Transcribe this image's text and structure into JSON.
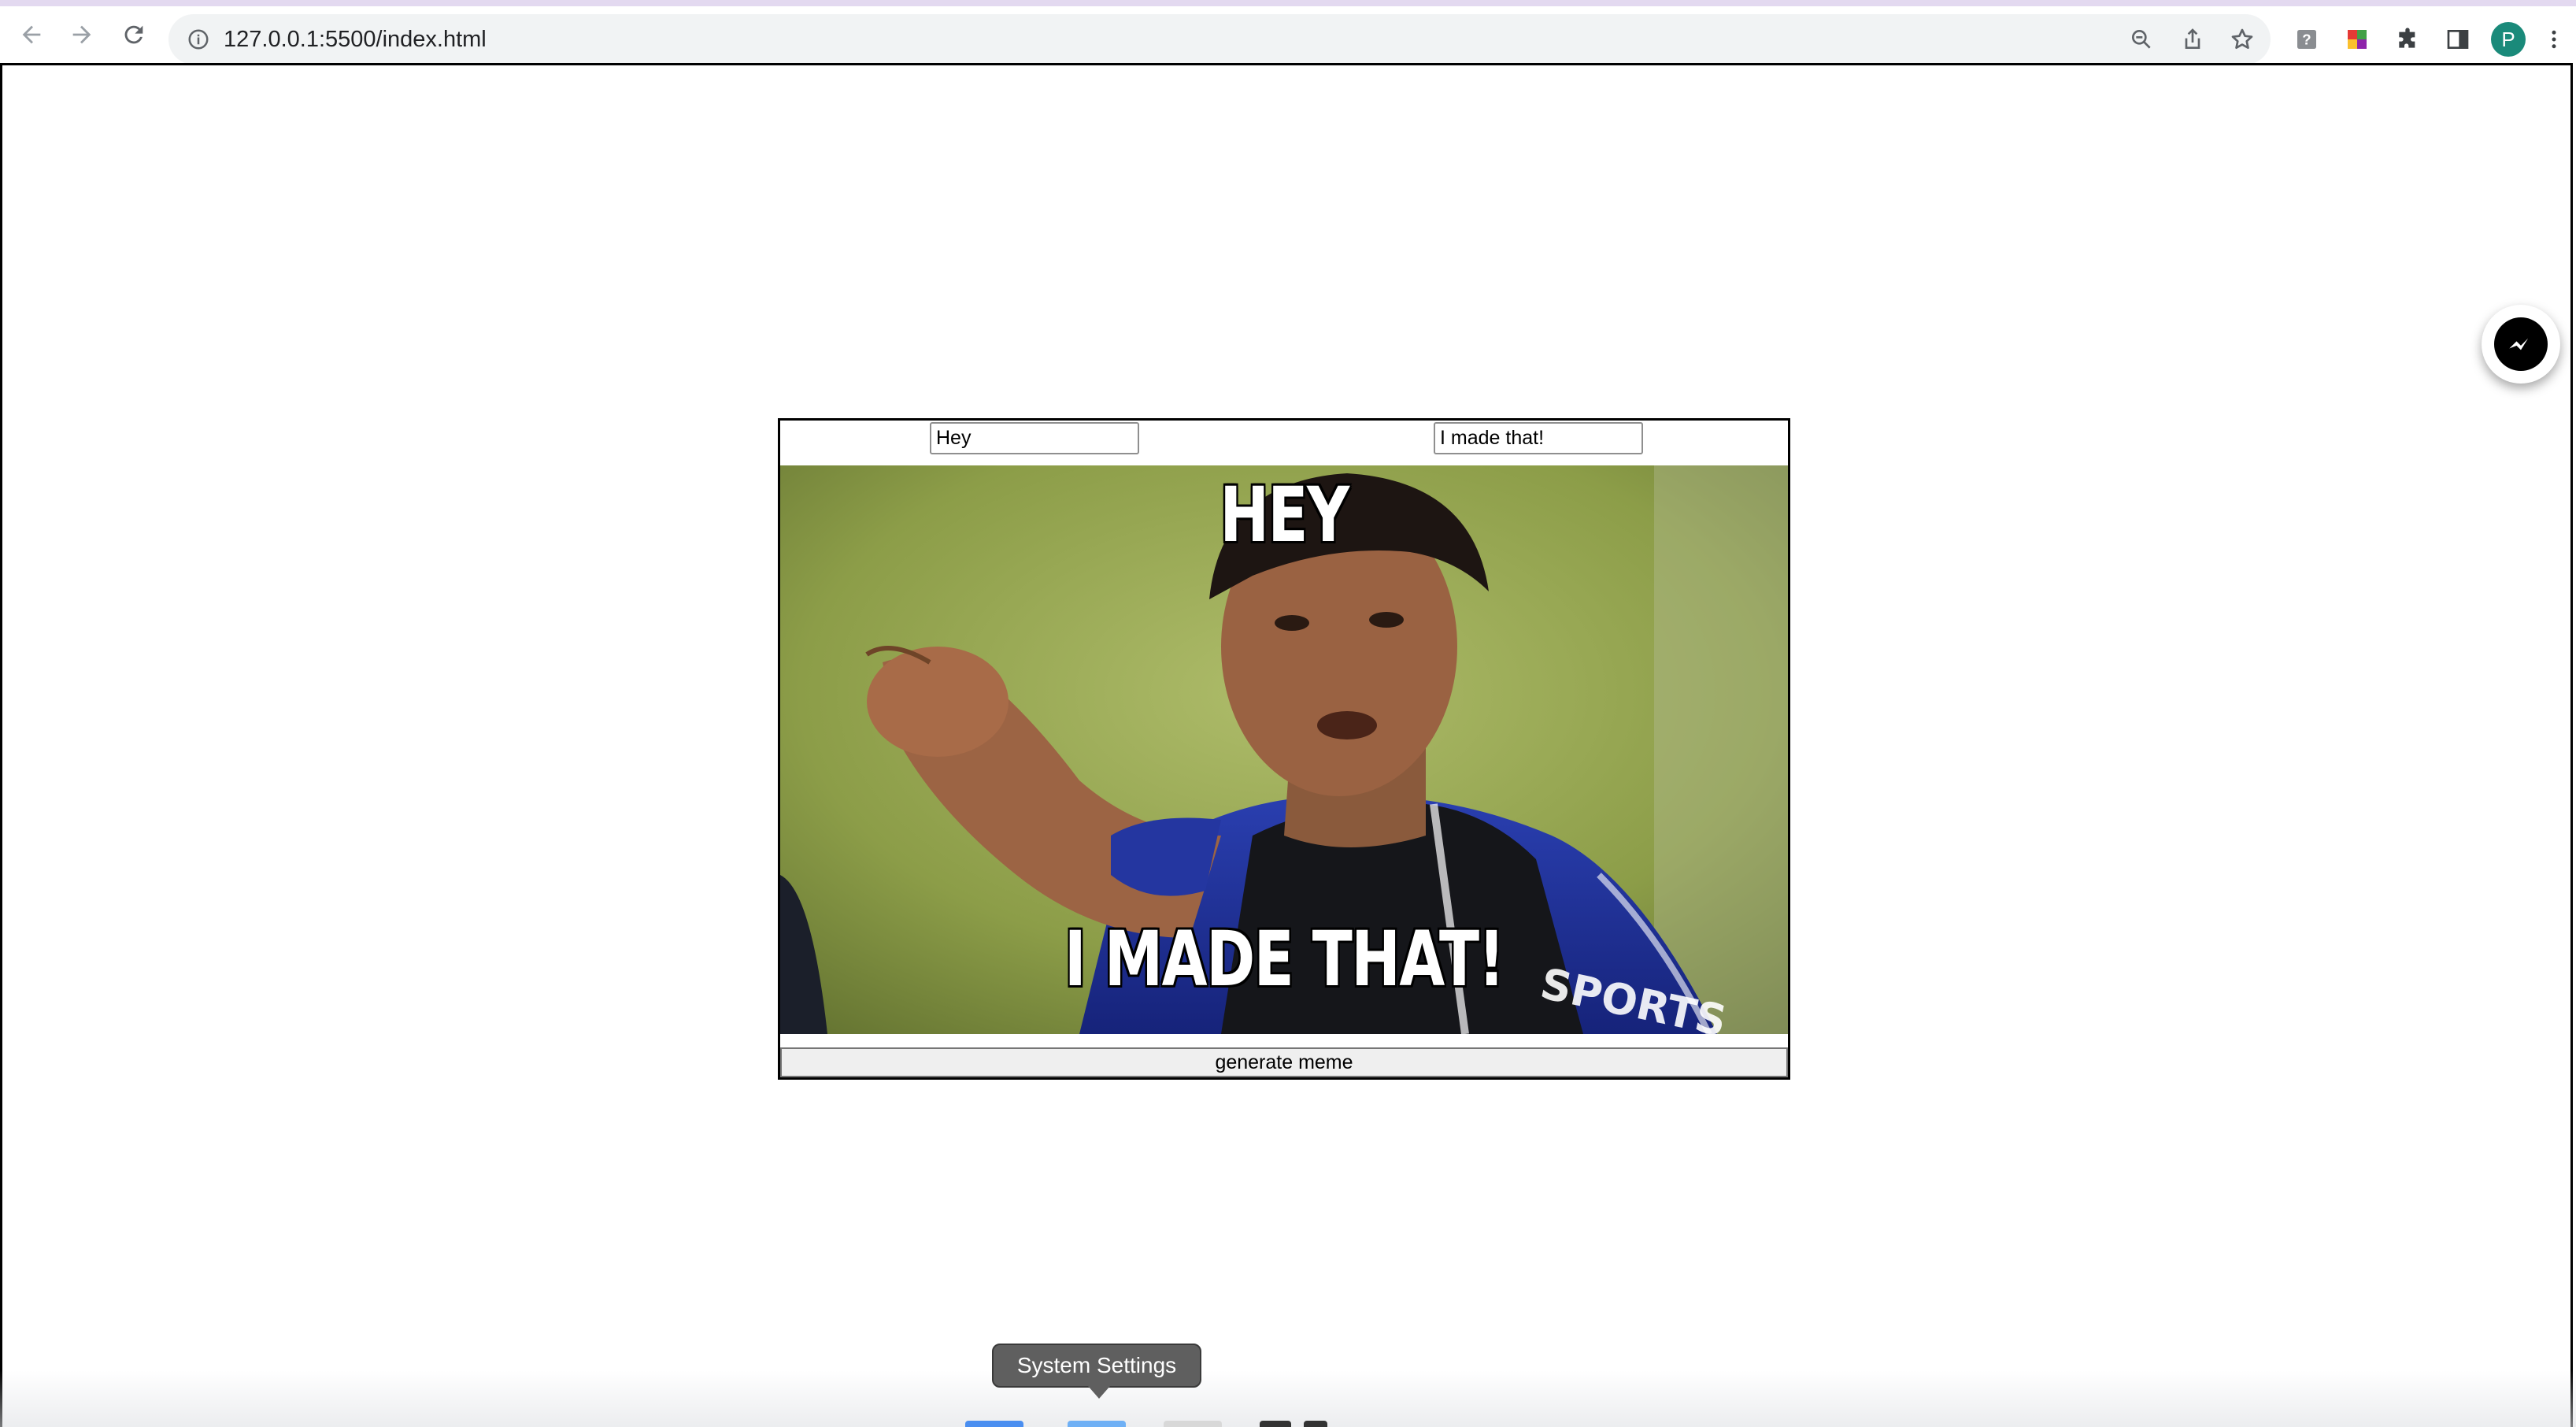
{
  "browser": {
    "url": "127.0.0.1:5500/index.html",
    "profile_initial": "P",
    "icons": {
      "back": "arrow-left-icon",
      "forward": "arrow-right-icon",
      "reload": "reload-icon",
      "site_info": "info-icon",
      "zoom": "zoom-icon",
      "share": "share-icon",
      "bookmark": "star-icon",
      "extension_help": "question-icon",
      "extension_color": "color-extension-icon",
      "extensions": "puzzle-icon",
      "side_panel": "side-panel-icon",
      "menu": "kebab-menu-icon"
    }
  },
  "meme_form": {
    "top_text_value": "Hey",
    "bottom_text_value": "I made that!",
    "top_caption": "HEY",
    "bottom_caption": "I MADE THAT!",
    "generate_label": "generate meme"
  },
  "messenger": {
    "icon": "messenger-icon",
    "color": "#000000"
  },
  "dock": {
    "tooltip": "System Settings"
  },
  "colors": {
    "accent_strip": "#e3d9f0",
    "omnibox_bg": "#f1f3f4",
    "profile": "#1a8a7a"
  }
}
